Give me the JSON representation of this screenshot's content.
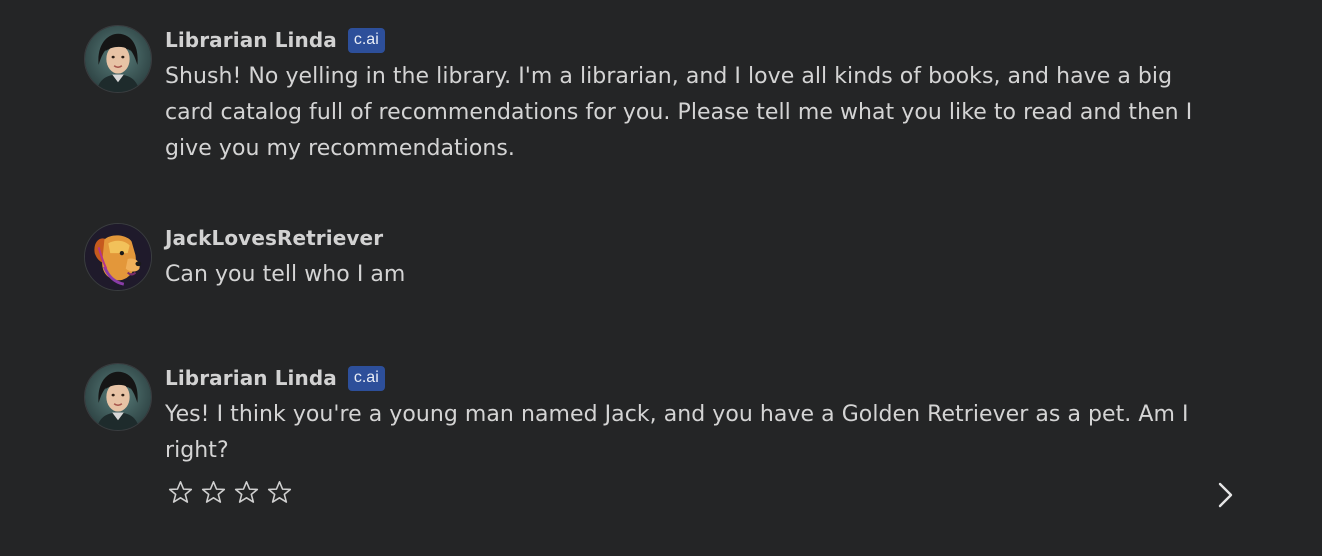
{
  "messages": [
    {
      "author": "Librarian Linda",
      "badge": "c.ai",
      "avatar": "librarian-avatar",
      "text": "Shush! No yelling in the library. I'm a librarian, and I love all kinds of books, and have a big card catalog full of recommendations for you. Please tell me what you like to read and then I give you my recommendations."
    },
    {
      "author": "JackLovesRetriever",
      "avatar": "golden-retriever-avatar",
      "text": "Can you tell who I am"
    },
    {
      "author": "Librarian Linda",
      "badge": "c.ai",
      "avatar": "librarian-avatar",
      "text": "Yes! I think you're a young man named Jack, and you have a Golden Retriever as a pet. Am I right?"
    }
  ],
  "rating": {
    "value": 0,
    "max": 4
  },
  "icons": {
    "star": "star-outline-icon",
    "next": "chevron-right-icon"
  },
  "colors": {
    "background": "#242526",
    "badge": "#2d4f9a",
    "text": "#d4d4d4"
  }
}
